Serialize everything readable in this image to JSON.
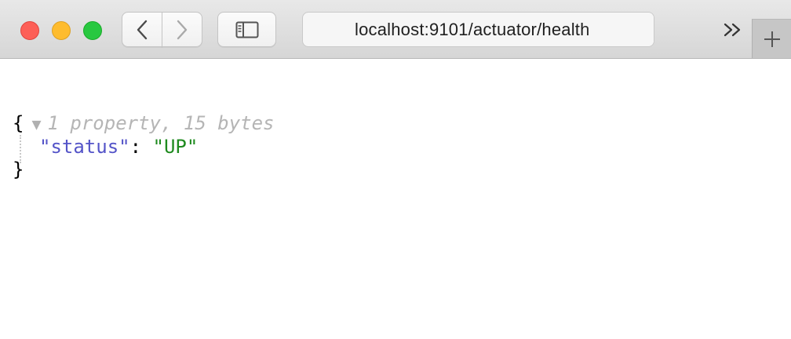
{
  "window": {
    "address_url": "localhost:9101/actuator/health"
  },
  "toolbar": {
    "icons": {
      "close": "close-window-icon",
      "minimize": "minimize-window-icon",
      "maximize": "maximize-window-icon",
      "back": "chevron-left-icon",
      "forward": "chevron-right-icon",
      "sidebar": "sidebar-icon",
      "overflow": "double-chevron-right-icon",
      "new_tab": "plus-icon"
    },
    "colors": {
      "close": "#fd5f57",
      "minimize": "#febc2e",
      "maximize": "#28c840"
    }
  },
  "json_view": {
    "open_brace": "{",
    "close_brace": "}",
    "toggle_glyph": "▼",
    "summary": "1 property, 15 bytes",
    "key": "\"status\"",
    "colon": ":",
    "value": "\"UP\"",
    "colors": {
      "key": "#5454c8",
      "string_value": "#1e8a1e",
      "summary": "#b5b5b5"
    }
  }
}
